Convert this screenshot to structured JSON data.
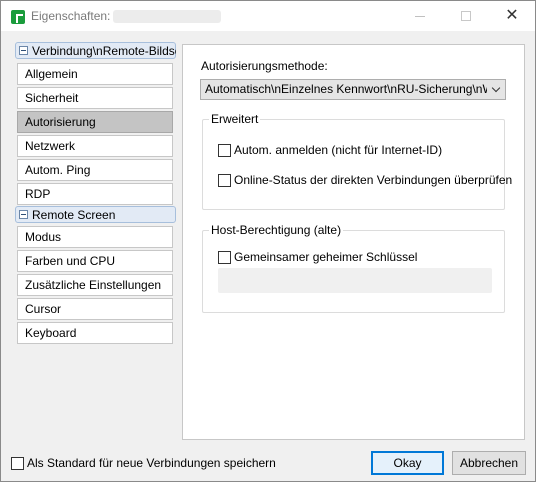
{
  "window": {
    "title": "Eigenschaften:",
    "controls": {
      "minimize": "minimize",
      "maximize": "maximize",
      "close": "✕"
    }
  },
  "sidebar": {
    "group1": {
      "label": "Verbindung\\nRemote-Bildsc...",
      "items": [
        "Allgemein",
        "Sicherheit",
        "Autorisierung",
        "Netzwerk",
        "Autom. Ping",
        "RDP"
      ]
    },
    "group2": {
      "label": "Remote Screen",
      "items": [
        "Modus",
        "Farben und CPU",
        "Zusätzliche Einstellungen",
        "Cursor",
        "Keyboard"
      ]
    },
    "selected": "Autorisierung"
  },
  "main": {
    "auth_method_label": "Autorisierungsmethode:",
    "auth_method_value": "Automatisch\\nEinzelnes Kennwort\\nRU-Sicherung\\nWindow",
    "advanced": {
      "legend": "Erweitert",
      "auto_login": "Autom. anmelden (nicht für Internet-ID)",
      "online_status": "Online-Status der direkten Verbindungen überprüfen"
    },
    "host_auth": {
      "legend": "Host-Berechtigung (alte)",
      "shared_secret": "Gemeinsamer geheimer Schlüssel"
    }
  },
  "footer": {
    "save_default": "Als Standard für neue Verbindungen speichern",
    "ok": "Okay",
    "cancel": "Abbrechen"
  }
}
